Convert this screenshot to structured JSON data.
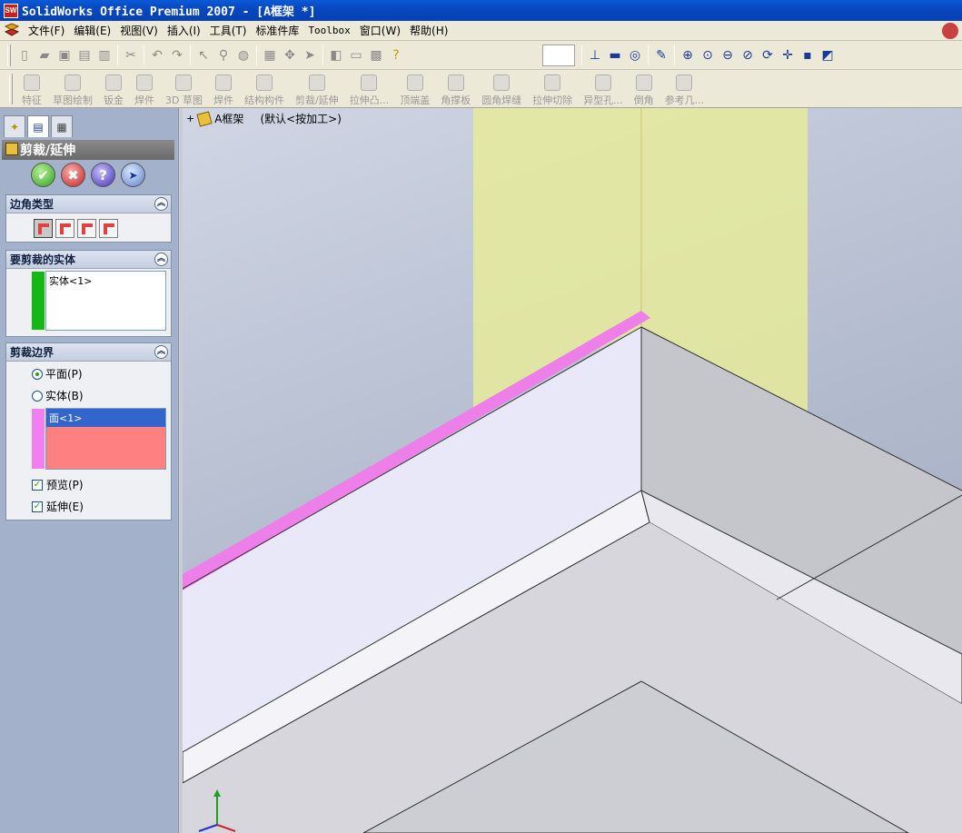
{
  "window": {
    "title": "SolidWorks Office Premium 2007 - [A框架 *]",
    "app_icon_text": "SW"
  },
  "menu": {
    "items": [
      "文件(F)",
      "编辑(E)",
      "视图(V)",
      "插入(I)",
      "工具(T)",
      "标准件库",
      "Toolbox",
      "窗口(W)",
      "帮助(H)"
    ]
  },
  "toolbar_features": {
    "items": [
      "特征",
      "草图绘制",
      "钣金",
      "焊件",
      "3D 草图",
      "焊件",
      "结构构件",
      "剪裁/延伸",
      "拉伸凸...",
      "顶端盖",
      "角撑板",
      "圆角焊缝",
      "拉伸切除",
      "异型孔...",
      "倒角",
      "参考几..."
    ]
  },
  "property_manager": {
    "title": "剪裁/延伸",
    "corner_type": {
      "title": "边角类型"
    },
    "bodies_to_trim": {
      "title": "要剪裁的实体",
      "items": [
        "实体<1>"
      ]
    },
    "trim_boundary": {
      "title": "剪裁边界",
      "options": [
        "平面(P)",
        "实体(B)"
      ],
      "selected_option": "平面(P)",
      "faces": [
        "面<1>"
      ],
      "preview_label": "预览(P)",
      "extend_label": "延伸(E)",
      "preview_checked": true,
      "extend_checked": true
    }
  },
  "viewport": {
    "tree_root": "A框架",
    "configuration": "(默认<按加工>)"
  },
  "colors": {
    "body_selection": "#14b814",
    "face_selection": "#f080f0",
    "face_highlight": "#ff8080",
    "trim_plane": "#e6eb9b",
    "ok": "#30a020",
    "cancel": "#c82020"
  },
  "icons": [
    "solidworks-logo-icon",
    "ok-icon",
    "cancel-icon",
    "help-icon",
    "pushpin-icon",
    "collapse-icon",
    "part-icon",
    "triad-icon"
  ]
}
